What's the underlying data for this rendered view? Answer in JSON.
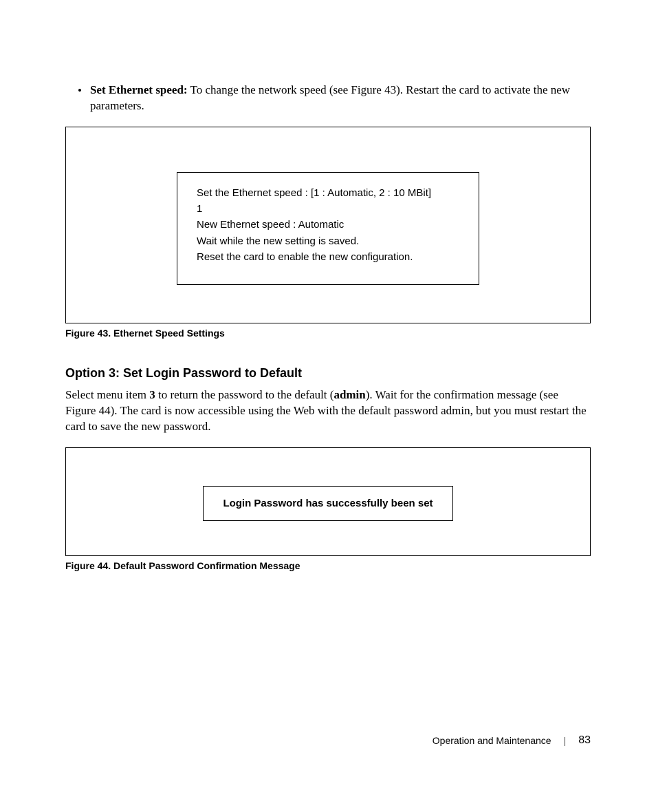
{
  "bullet": {
    "label": "Set Ethernet speed:",
    "text": " To change the network speed (see Figure 43). Restart the card to activate the new parameters."
  },
  "figure43": {
    "line1": "Set the Ethernet speed : [1 : Automatic, 2 : 10 MBit]",
    "line2": "1",
    "line3": "New Ethernet speed : Automatic",
    "line4": "Wait while the new setting is saved.",
    "line5": "Reset the card to enable the new configuration.",
    "caption": "Figure 43. Ethernet Speed Settings"
  },
  "section": {
    "heading": "Option 3: Set Login Password to Default",
    "para_pre": "Select menu item ",
    "para_bold1": "3",
    "para_mid": " to return the password to the default (",
    "para_bold2": "admin",
    "para_post": "). Wait for the confirmation message (see Figure 44). The card is now accessible using the Web with the default password admin, but you must restart the card to save the new password."
  },
  "figure44": {
    "text": "Login Password has successfully been set",
    "caption": "Figure 44. Default Password Confirmation Message"
  },
  "footer": {
    "section_name": "Operation and Maintenance",
    "page_number": "83"
  }
}
